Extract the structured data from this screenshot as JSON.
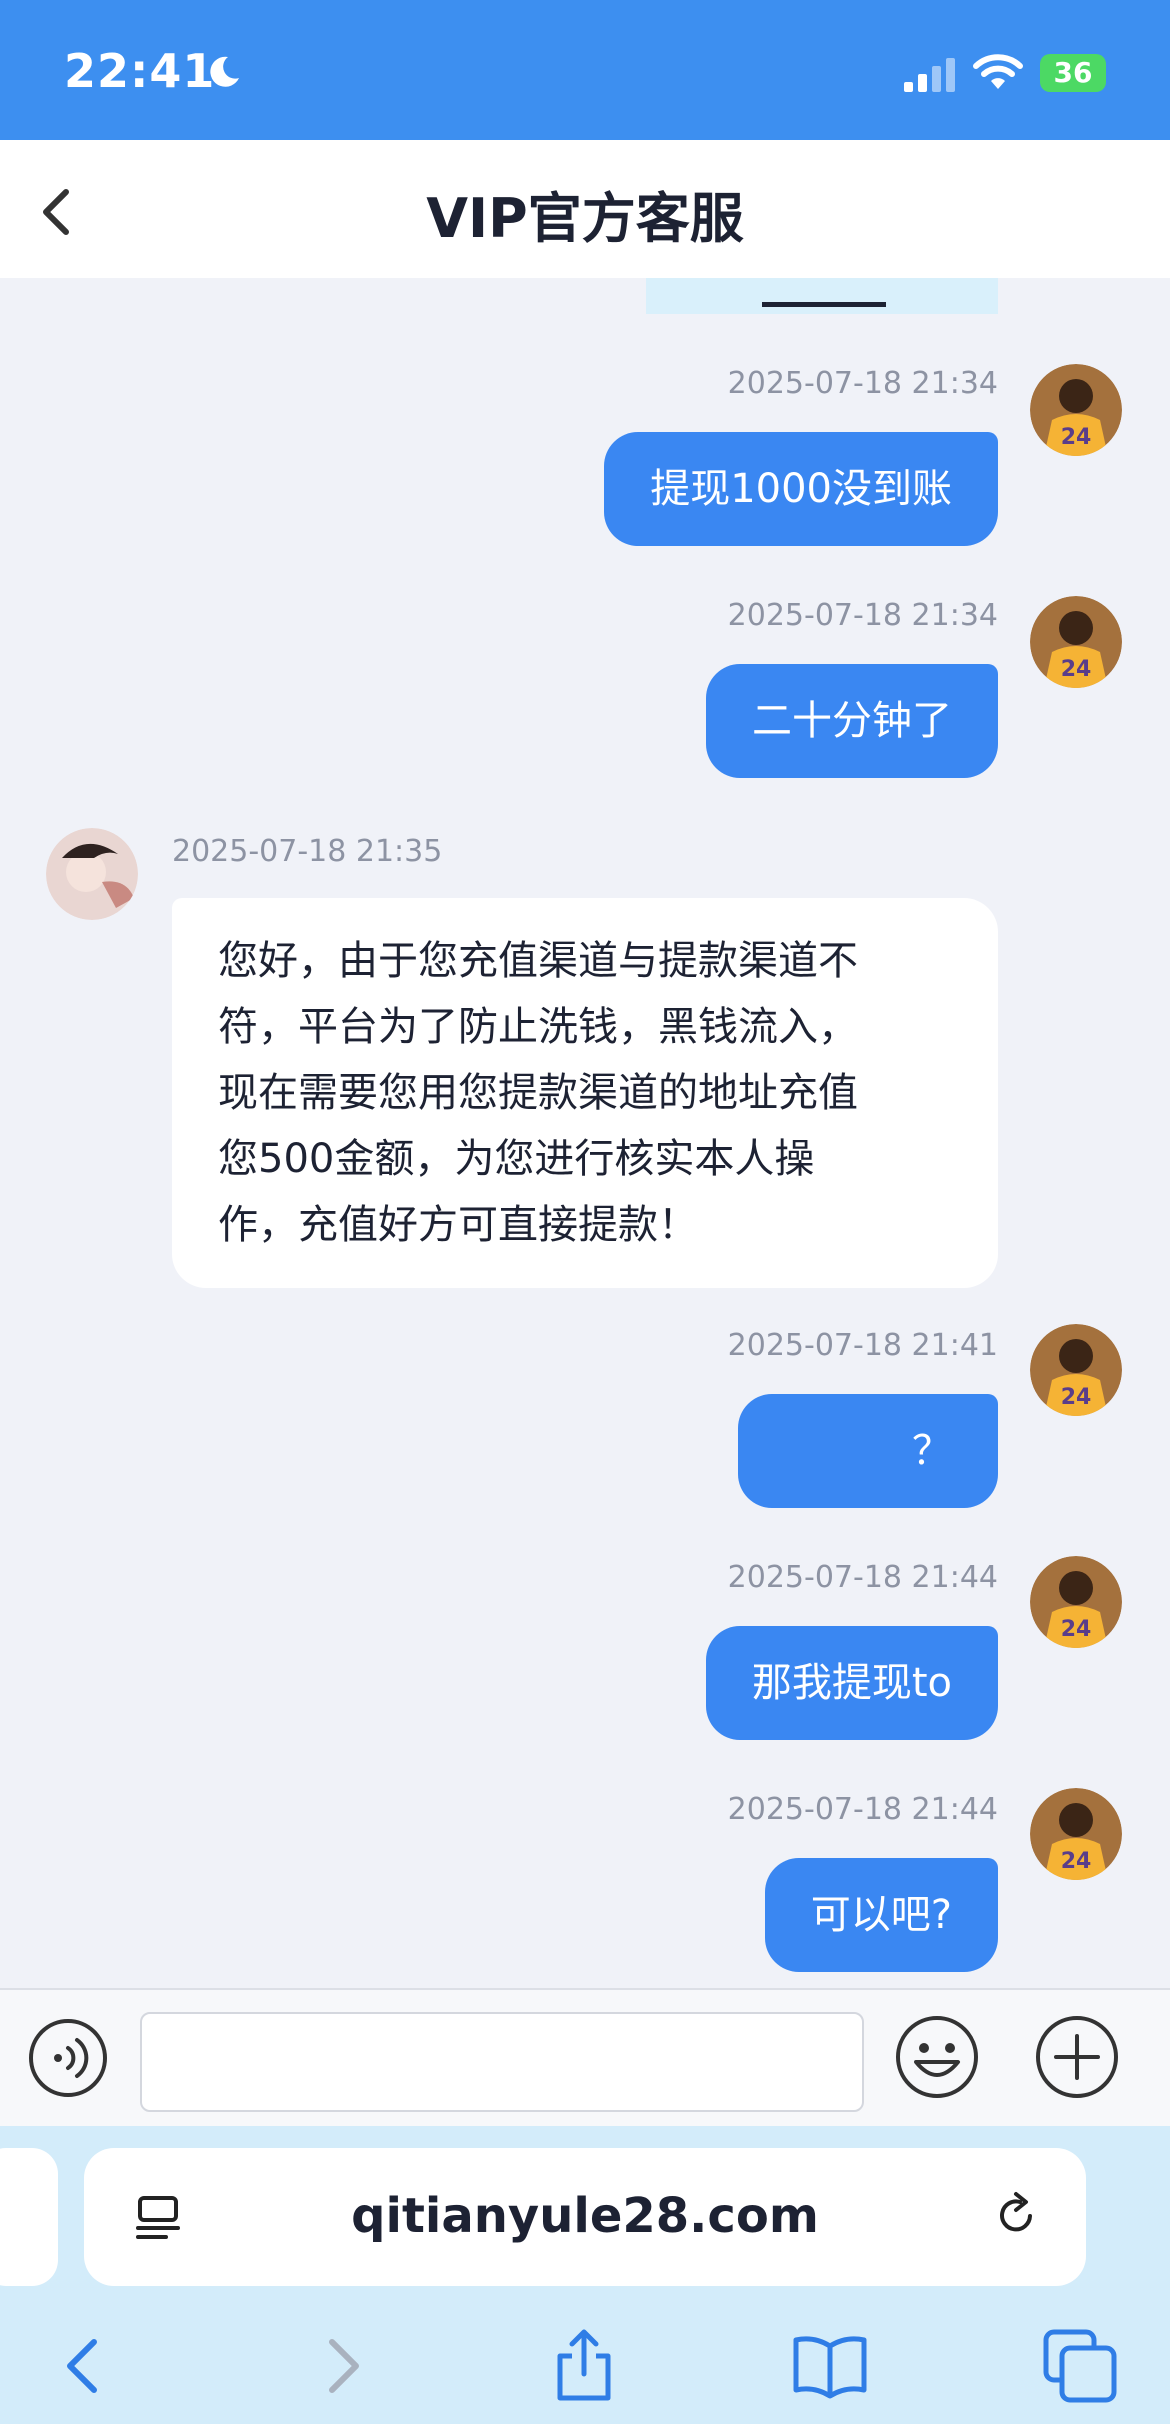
{
  "status_bar": {
    "time": "22:41",
    "battery": "36"
  },
  "header": {
    "title": "VIP官方客服"
  },
  "messages": [
    {
      "side": "out",
      "time": "2025-07-18 21:34",
      "text": "提现1000没到账"
    },
    {
      "side": "out",
      "time": "2025-07-18 21:34",
      "text": "二十分钟了"
    },
    {
      "side": "in",
      "time": "2025-07-18 21:35",
      "lines": [
        "您好，由于您充值渠道与提款渠道不",
        "符，平台为了防止洗钱，黑钱流入，",
        "现在需要您用您提款渠道的地址充值",
        "您500金额，为您进行核实本人操",
        "作，充值好方可直接提款！"
      ]
    },
    {
      "side": "out",
      "time": "2025-07-18 21:41",
      "text": "？"
    },
    {
      "side": "out",
      "time": "2025-07-18 21:44",
      "text": "那我提现to"
    },
    {
      "side": "out",
      "time": "2025-07-18 21:44",
      "text": "可以吧?"
    }
  ],
  "input": {
    "placeholder": ""
  },
  "browser": {
    "url": "qitianyule28.com"
  },
  "colors": {
    "status_bar": "#3d8ff0",
    "outgoing_bubble": "#3a87f2",
    "incoming_bubble": "#ffffff",
    "chat_background": "#f0f2f8",
    "browser_chrome": "#d3ecfa"
  }
}
